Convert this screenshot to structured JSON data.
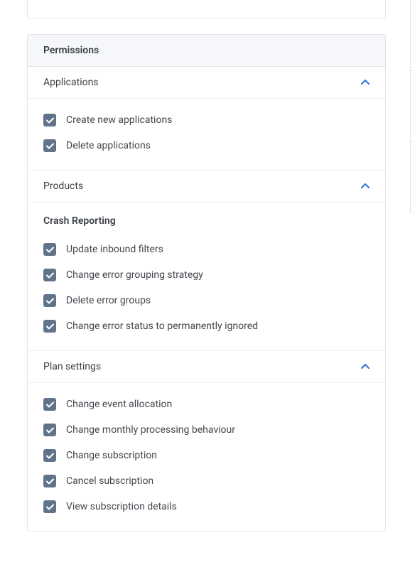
{
  "panel": {
    "title": "Permissions"
  },
  "sections": {
    "applications": {
      "label": "Applications",
      "items": [
        {
          "label": "Create new applications",
          "checked": true
        },
        {
          "label": "Delete applications",
          "checked": true
        }
      ]
    },
    "products": {
      "label": "Products",
      "subheading": "Crash Reporting",
      "items": [
        {
          "label": "Update inbound filters",
          "checked": true
        },
        {
          "label": "Change error grouping strategy",
          "checked": true
        },
        {
          "label": "Delete error groups",
          "checked": true
        },
        {
          "label": "Change error status to permanently ignored",
          "checked": true
        }
      ]
    },
    "plan": {
      "label": "Plan settings",
      "items": [
        {
          "label": "Change event allocation",
          "checked": true
        },
        {
          "label": "Change monthly processing behaviour",
          "checked": true
        },
        {
          "label": "Change subscription",
          "checked": true
        },
        {
          "label": "Cancel subscription",
          "checked": true
        },
        {
          "label": "View subscription details",
          "checked": true
        }
      ]
    }
  },
  "colors": {
    "accent": "#2e6fd9",
    "checkbox": "#61738a"
  }
}
